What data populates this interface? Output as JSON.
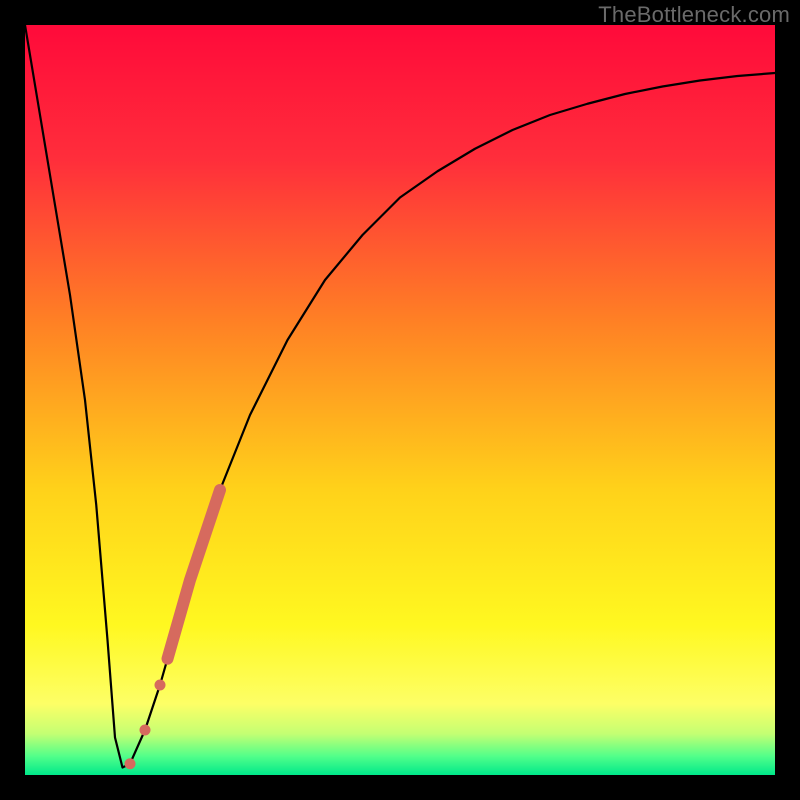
{
  "attribution": "TheBottleneck.com",
  "colors": {
    "frame": "#000000",
    "curve": "#000000",
    "marker": "#d66a5e",
    "gradient_stops": [
      {
        "offset": 0.0,
        "color": "#ff0a3a"
      },
      {
        "offset": 0.18,
        "color": "#ff2e3b"
      },
      {
        "offset": 0.4,
        "color": "#ff8224"
      },
      {
        "offset": 0.62,
        "color": "#ffd21a"
      },
      {
        "offset": 0.8,
        "color": "#fff820"
      },
      {
        "offset": 0.905,
        "color": "#fdff66"
      },
      {
        "offset": 0.945,
        "color": "#c4ff73"
      },
      {
        "offset": 0.975,
        "color": "#52ff8a"
      },
      {
        "offset": 1.0,
        "color": "#00e88a"
      }
    ]
  },
  "chart_data": {
    "type": "line",
    "title": "",
    "xlabel": "",
    "ylabel": "",
    "xlim": [
      0,
      100
    ],
    "ylim": [
      0,
      100
    ],
    "series": [
      {
        "name": "bottleneck-curve",
        "x": [
          0,
          2,
          4,
          6,
          8,
          9.5,
          11,
          12,
          13,
          14,
          16,
          18,
          20,
          22,
          24,
          26,
          30,
          35,
          40,
          45,
          50,
          55,
          60,
          65,
          70,
          75,
          80,
          85,
          90,
          95,
          100
        ],
        "y": [
          100,
          88,
          76,
          64,
          50,
          36,
          18,
          5,
          1,
          1.5,
          6,
          12,
          19,
          26,
          32,
          38,
          48,
          58,
          66,
          72,
          77,
          80.5,
          83.5,
          86,
          88,
          89.5,
          90.8,
          91.8,
          92.6,
          93.2,
          93.6
        ]
      }
    ],
    "markers": {
      "name": "highlighted-segment",
      "points": [
        {
          "x": 14.0,
          "y": 1.5
        },
        {
          "x": 16.0,
          "y": 6.0
        },
        {
          "x": 18.0,
          "y": 12.0
        },
        {
          "x": 19.0,
          "y": 15.5
        },
        {
          "x": 20.0,
          "y": 19.0
        },
        {
          "x": 21.0,
          "y": 22.5
        },
        {
          "x": 22.0,
          "y": 26.0
        },
        {
          "x": 23.0,
          "y": 29.0
        },
        {
          "x": 24.0,
          "y": 32.0
        },
        {
          "x": 25.0,
          "y": 35.0
        },
        {
          "x": 26.0,
          "y": 38.0
        }
      ]
    }
  }
}
